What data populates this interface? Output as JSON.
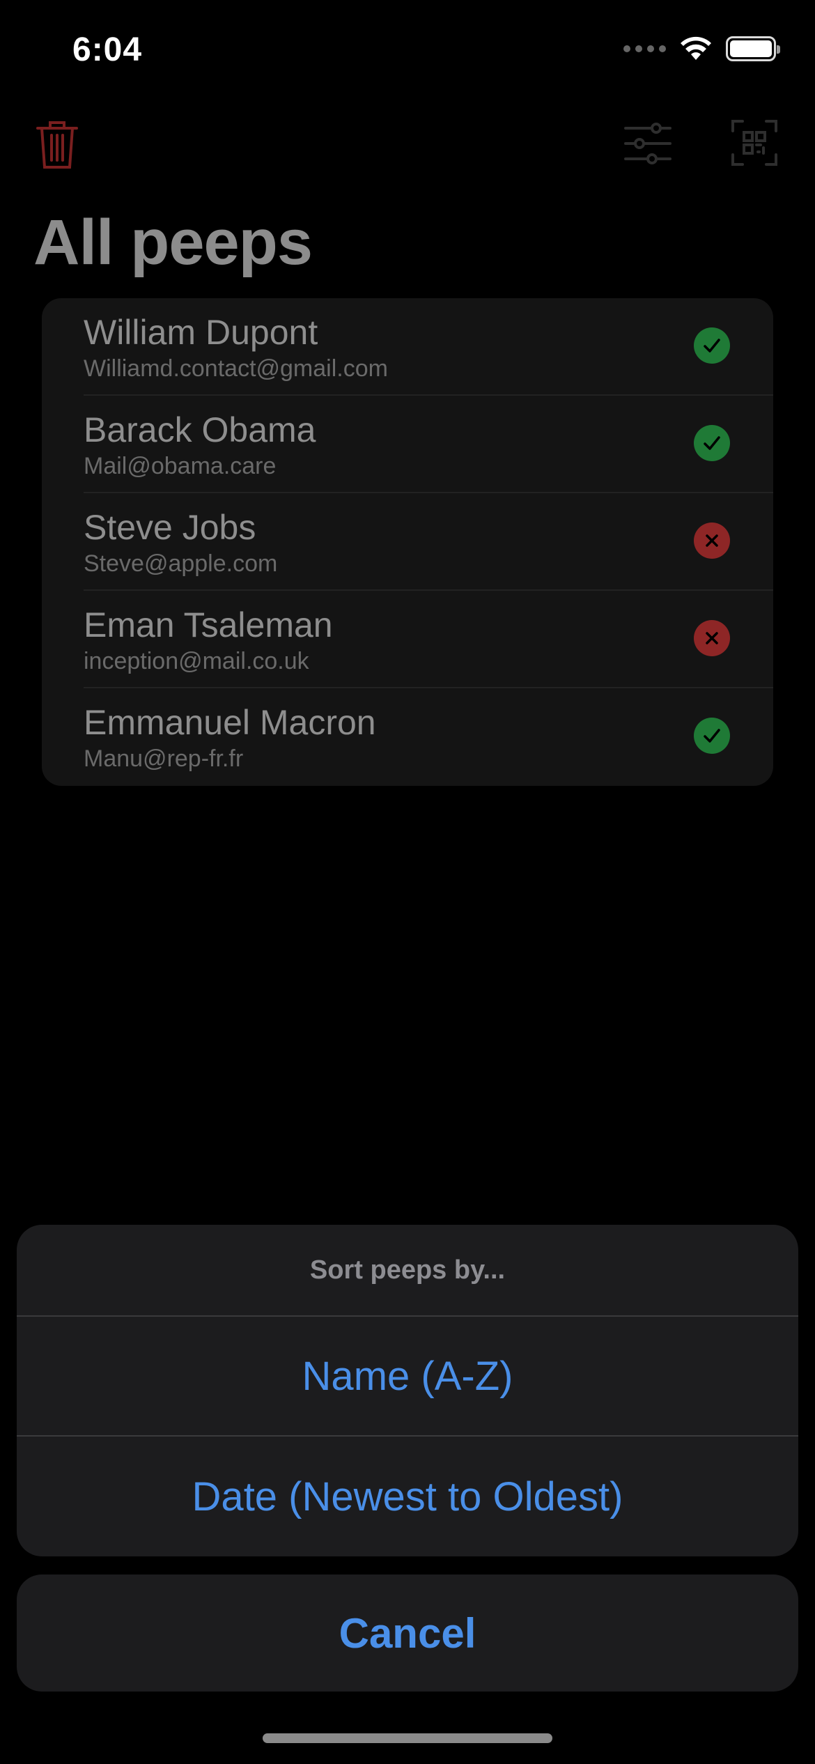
{
  "status_bar": {
    "time": "6:04"
  },
  "toolbar": {
    "icons": [
      "trash-icon",
      "filter-sliders-icon",
      "qr-scan-icon"
    ],
    "trash_color": "#7a1f1f"
  },
  "page": {
    "title": "All peeps"
  },
  "contacts": [
    {
      "name": "William Dupont",
      "email": "Williamd.contact@gmail.com",
      "status": "checkmark-icon"
    },
    {
      "name": "Barack Obama",
      "email": "Mail@obama.care",
      "status": "checkmark-icon"
    },
    {
      "name": "Steve Jobs",
      "email": "Steve@apple.com",
      "status": "xmark-icon"
    },
    {
      "name": "Eman Tsaleman",
      "email": "inception@mail.co.uk",
      "status": "xmark-icon"
    },
    {
      "name": "Emmanuel Macron",
      "email": "Manu@rep-fr.fr",
      "status": "checkmark-icon"
    }
  ],
  "action_sheet": {
    "title": "Sort peeps by...",
    "options": [
      "Name (A-Z)",
      "Date (Newest to Oldest)"
    ],
    "cancel_label": "Cancel"
  },
  "colors": {
    "accent": "#4a8fe8",
    "status_ok": "#1f7a36",
    "status_bad": "#8e2626"
  }
}
